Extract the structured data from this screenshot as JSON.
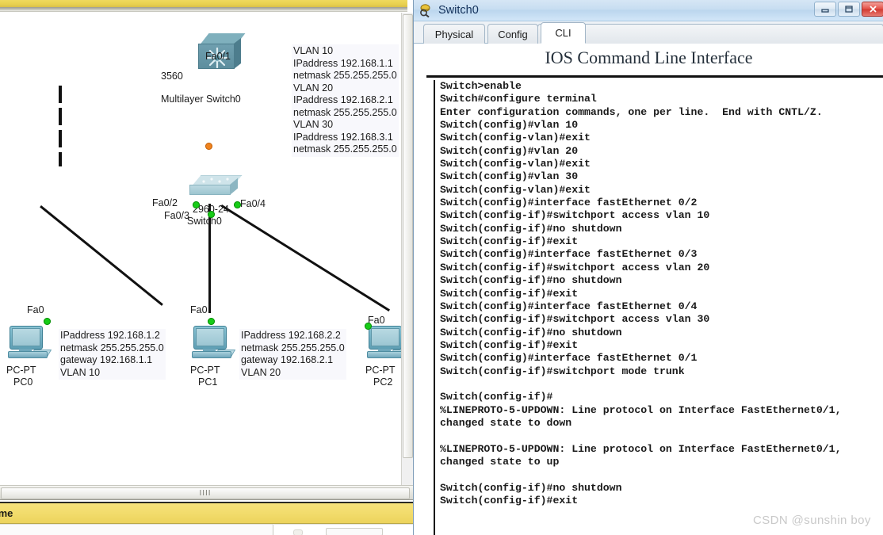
{
  "workspace": {
    "bottom_bar_label": "ime",
    "scrollbar_grip": "IIII",
    "devices": [
      {
        "name": "multilayer-switch",
        "model_label": "3560",
        "device_label": "Multilayer Switch0",
        "port_label": "Fa0/1",
        "link_state": "down"
      },
      {
        "name": "access-switch",
        "model_label": "2960-24",
        "device_label": "Switch0",
        "ports": [
          "Fa0/2",
          "Fa0/3",
          "Fa0/4"
        ],
        "uplink_port": "Fa0/1"
      },
      {
        "name": "pc0",
        "type_label": "PC-PT",
        "device_label": "PC0",
        "port_label": "Fa0"
      },
      {
        "name": "pc1",
        "type_label": "PC-PT",
        "device_label": "PC1",
        "port_label": "Fa0"
      },
      {
        "name": "pc2",
        "type_label": "PC-PT",
        "device_label": "PC2",
        "port_label": "Fa0"
      }
    ],
    "vlan_note": "VLAN 10\nIPaddress 192.168.1.1\nnetmask 255.255.255.0\nVLAN 20\nIPaddress 192.168.2.1\nnetmask 255.255.255.0\nVLAN 30\nIPaddress 192.168.3.1\nnetmask 255.255.255.0",
    "pc0_note": "IPaddress 192.168.1.2\nnetmask 255.255.255.0\ngateway 192.168.1.1\nVLAN 10",
    "pc1_note": "IPaddress 192.168.2.2\nnetmask 255.255.255.0\ngateway 192.168.2.1\nVLAN 20"
  },
  "cli_window": {
    "title": "Switch0",
    "title_icon": "packet-tracer-device-icon",
    "buttons": {
      "minimize": "–",
      "maximize": "□",
      "close": "✕"
    },
    "tabs": [
      {
        "label": "Physical",
        "active": false
      },
      {
        "label": "Config",
        "active": false
      },
      {
        "label": "CLI",
        "active": true
      }
    ],
    "heading": "IOS Command Line Interface",
    "terminal": "Switch>enable\nSwitch#configure terminal\nEnter configuration commands, one per line.  End with CNTL/Z.\nSwitch(config)#vlan 10\nSwitch(config-vlan)#exit\nSwitch(config)#vlan 20\nSwitch(config-vlan)#exit\nSwitch(config)#vlan 30\nSwitch(config-vlan)#exit\nSwitch(config)#interface fastEthernet 0/2\nSwitch(config-if)#switchport access vlan 10\nSwitch(config-if)#no shutdown\nSwitch(config-if)#exit\nSwitch(config)#interface fastEthernet 0/3\nSwitch(config-if)#switchport access vlan 20\nSwitch(config-if)#no shutdown\nSwitch(config-if)#exit\nSwitch(config)#interface fastEthernet 0/4\nSwitch(config-if)#switchport access vlan 30\nSwitch(config-if)#no shutdown\nSwitch(config-if)#exit\nSwitch(config)#interface fastEthernet 0/1\nSwitch(config-if)#switchport mode trunk\n\nSwitch(config-if)#\n%LINEPROTO-5-UPDOWN: Line protocol on Interface FastEthernet0/1,\nchanged state to down\n\n%LINEPROTO-5-UPDOWN: Line protocol on Interface FastEthernet0/1,\nchanged state to up\n\nSwitch(config-if)#no shutdown\nSwitch(config-if)#exit"
  },
  "watermark": "CSDN @sunshin boy",
  "colors": {
    "link_up": "#17cc17",
    "link_down": "#f0831e",
    "title_bar": "#c7ddf1",
    "status_bar": "#f2dc6c"
  }
}
